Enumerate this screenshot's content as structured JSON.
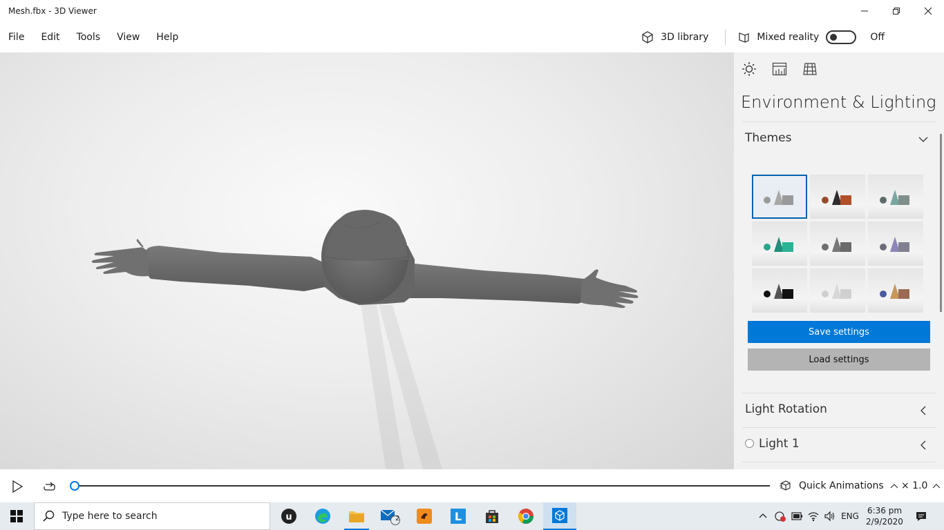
{
  "window": {
    "title": "Mesh.fbx - 3D Viewer"
  },
  "menu": {
    "file": "File",
    "edit": "Edit",
    "tools": "Tools",
    "view": "View",
    "help": "Help"
  },
  "toolbar": {
    "library_label": "3D library",
    "mixed_reality_label": "Mixed reality",
    "mixed_reality_state": "Off"
  },
  "panel": {
    "title": "Environment & Lighting",
    "themes_label": "Themes",
    "save_label": "Save settings",
    "load_label": "Load settings",
    "light_rotation_label": "Light Rotation",
    "light1_label": "Light 1",
    "themes": [
      {
        "name": "default-theme",
        "selected": true
      },
      {
        "name": "warm-theme",
        "selected": false
      },
      {
        "name": "teal-theme",
        "selected": false
      },
      {
        "name": "green-theme",
        "selected": false
      },
      {
        "name": "grey-theme",
        "selected": false
      },
      {
        "name": "violet-theme",
        "selected": false
      },
      {
        "name": "dark-theme",
        "selected": false
      },
      {
        "name": "light-theme",
        "selected": false
      },
      {
        "name": "gradient-theme",
        "selected": false
      }
    ]
  },
  "timeline": {
    "animations_label": "Quick Animations",
    "speed": "× 1.0"
  },
  "taskbar": {
    "search_placeholder": "Type here to search",
    "mail_badge": "2",
    "language": "ENG",
    "time": "6:36 pm",
    "date": "2/9/2020"
  },
  "colors": {
    "accent": "#0078d7",
    "model": "#6e6e6e"
  }
}
